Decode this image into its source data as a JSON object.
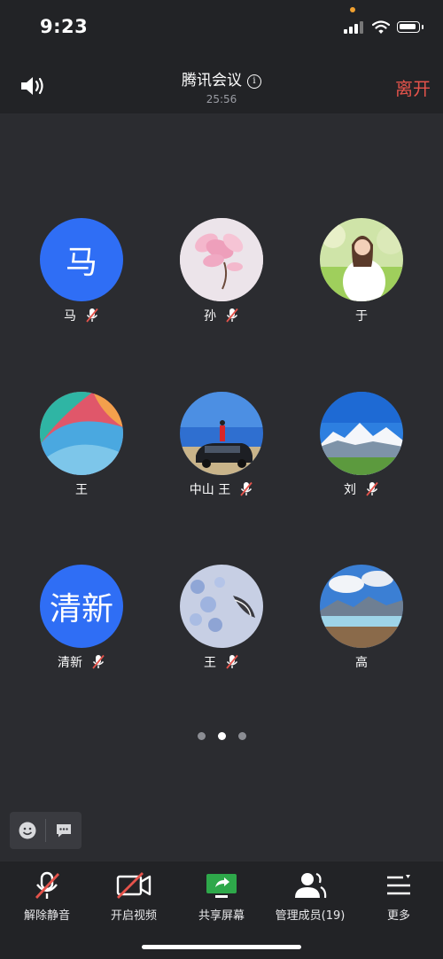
{
  "status_bar": {
    "time": "9:23"
  },
  "header": {
    "title": "腾讯会议",
    "duration": "25:56",
    "leave_label": "离开"
  },
  "participants": [
    {
      "name": "马",
      "avatar_text": "马",
      "muted": true
    },
    {
      "name": "孙",
      "muted": true
    },
    {
      "name": "于",
      "muted": false
    },
    {
      "name": "王",
      "muted": false
    },
    {
      "name": "中山 王",
      "muted": true
    },
    {
      "name": "刘",
      "muted": true
    },
    {
      "name": "清新",
      "avatar_text": "清新",
      "muted": true
    },
    {
      "name": "王",
      "muted": true
    },
    {
      "name": "高",
      "muted": false
    }
  ],
  "pagination": {
    "pages": 3,
    "current": 2
  },
  "toolbar": {
    "unmute_label": "解除静音",
    "video_label": "开启视频",
    "share_label": "共享屏幕",
    "members_label": "管理成员(19)",
    "more_label": "更多"
  },
  "colors": {
    "accent_blue": "#2f6ef5",
    "leave_red": "#e5534b",
    "share_green": "#2ea84a",
    "background": "#2b2c30"
  }
}
